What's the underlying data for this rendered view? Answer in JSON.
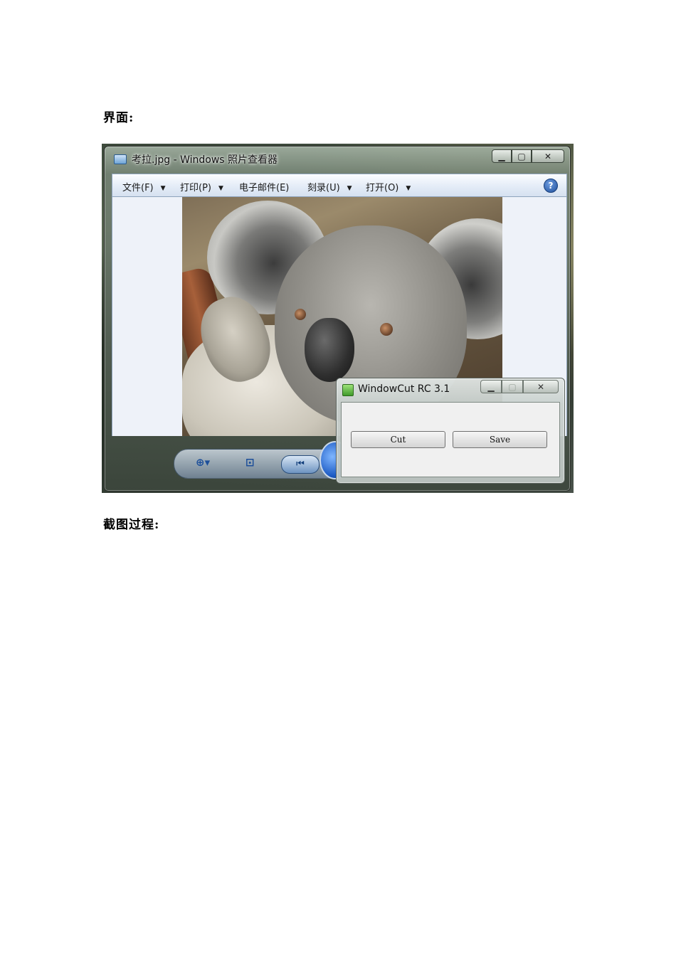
{
  "document": {
    "heading_interface": "界面:",
    "heading_process": "截图过程:"
  },
  "photo_viewer": {
    "title": "考拉.jpg - Windows 照片查看器",
    "menu": [
      {
        "label": "文件(F)",
        "has_dropdown": true
      },
      {
        "label": "打印(P)",
        "has_dropdown": true
      },
      {
        "label": "电子邮件(E)",
        "has_dropdown": false
      },
      {
        "label": "刻录(U)",
        "has_dropdown": true
      },
      {
        "label": "打开(O)",
        "has_dropdown": true
      }
    ],
    "icons": [
      "app-icon",
      "help-icon",
      "zoom-icon",
      "fit-icon",
      "previous-icon",
      "play-slideshow-icon"
    ]
  },
  "windowcut": {
    "title": "WindowCut RC 3.1",
    "cut_label": "Cut",
    "save_label": "Save"
  }
}
